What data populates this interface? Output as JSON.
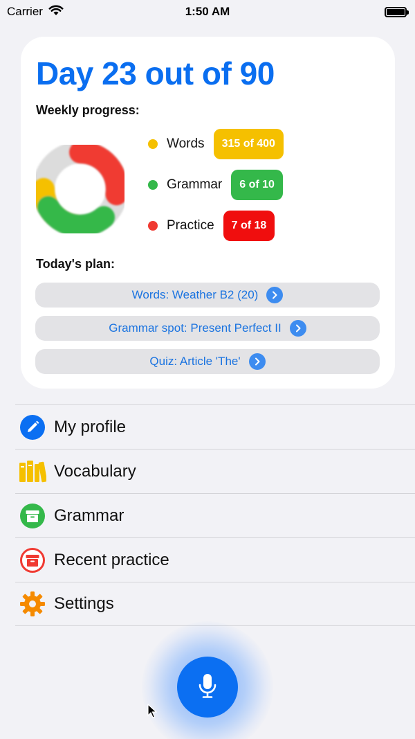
{
  "status_bar": {
    "carrier": "Carrier",
    "time": "1:50 AM"
  },
  "card": {
    "title": "Day 23 out of 90",
    "weekly_label": "Weekly progress:",
    "progress": [
      {
        "label": "Words",
        "badge": "315 of 400",
        "done": 315,
        "total": 400,
        "color": "#f5c000"
      },
      {
        "label": "Grammar",
        "badge": "6 of 10",
        "done": 6,
        "total": 10,
        "color": "#34b84a"
      },
      {
        "label": "Practice",
        "badge": "7 of 18",
        "done": 7,
        "total": 18,
        "color": "#f03a32"
      }
    ],
    "plan_label": "Today's plan:",
    "plan": [
      {
        "label": "Words: Weather B2 (20)"
      },
      {
        "label": "Grammar spot: Present Perfect II"
      },
      {
        "label": "Quiz: Article 'The'"
      }
    ]
  },
  "menu": [
    {
      "label": "My profile",
      "icon": "pencil-icon"
    },
    {
      "label": "Vocabulary",
      "icon": "books-icon"
    },
    {
      "label": "Grammar",
      "icon": "archive-box-icon"
    },
    {
      "label": "Recent practice",
      "icon": "archive-box-outline-icon"
    },
    {
      "label": "Settings",
      "icon": "gear-icon"
    }
  ],
  "colors": {
    "accent": "#0a6ef0",
    "words": "#f5c000",
    "grammar": "#34b84a",
    "practice": "#f03a32",
    "donut_track": "#dcdcdc"
  },
  "mic": {
    "icon": "microphone-icon"
  }
}
